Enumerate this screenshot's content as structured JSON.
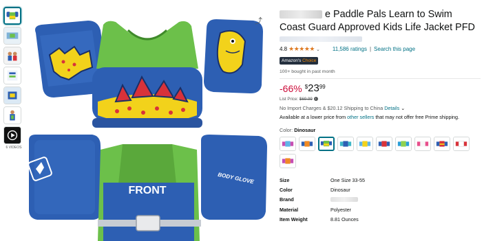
{
  "product": {
    "title_visible": "e Paddle Pals Learn to Swim Coast Guard Approved Kids Life Jacket PFD",
    "rating_value": "4.8",
    "stars": "★★★★★",
    "ratings_count": "11,586 ratings",
    "search_link": "Search this page",
    "badge_prefix": "Amazon's",
    "badge_choice": "Choice",
    "bought": "100+ bought in past month",
    "discount": "-66%",
    "currency": "$",
    "price_whole": "23",
    "price_frac": "99",
    "list_price_label": "List Price:",
    "list_price": "$69.99",
    "shipping_text": "No Import Charges & $20.12 Shipping to China",
    "details_link": "Details",
    "avail_prefix": "Available at a lower price from",
    "avail_link": "other sellers",
    "avail_suffix": "that may not offer free Prime shipping.",
    "color_label": "Color:",
    "color_value": "Dinosaur"
  },
  "gallery": {
    "videos_label": "6 VIDEOS",
    "front_text": "FRONT",
    "brand_mark": "BODY GLOVE"
  },
  "specs": [
    {
      "key": "Size",
      "value": "One Size 33-55"
    },
    {
      "key": "Color",
      "value": "Dinosaur"
    },
    {
      "key": "Brand",
      "value": ""
    },
    {
      "key": "Material",
      "value": "Polyester"
    },
    {
      "key": "Item Weight",
      "value": "8.81 Ounces"
    }
  ],
  "colors": {
    "blue": "#2d5fb3",
    "green": "#6cc04a",
    "yellow": "#f2d21b",
    "red": "#d8323a",
    "accent_link": "#007185",
    "deal_red": "#cc0c39",
    "star": "#de7921"
  }
}
